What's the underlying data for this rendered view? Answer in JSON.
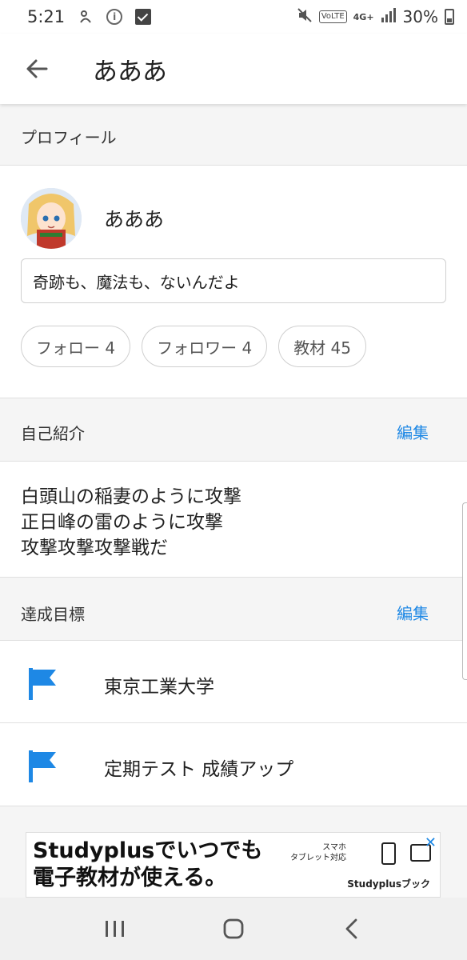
{
  "status_bar": {
    "time": "5:21",
    "network": "4G+",
    "volte": "VoLTE",
    "battery": "30%"
  },
  "app_bar": {
    "title": "あああ"
  },
  "profile": {
    "section_label": "プロフィール",
    "name": "あああ",
    "motto": "奇跡も、魔法も、ないんだよ",
    "chips": {
      "follow": "フォロー 4",
      "followers": "フォロワー 4",
      "materials": "教材 45"
    }
  },
  "intro": {
    "section_label": "自己紹介",
    "edit_label": "編集",
    "text": "白頭山の稲妻のように攻撃\n正日峰の雷のように攻撃\n攻撃攻撃攻撃戦だ"
  },
  "goals": {
    "section_label": "達成目標",
    "edit_label": "編集",
    "items": [
      {
        "label": "東京工業大学"
      },
      {
        "label": "定期テスト 成績アップ"
      }
    ],
    "flag_color": "#1e88e5"
  },
  "ad": {
    "headline": "Studyplusでいつでも\n電子教材が使える。",
    "sub": "スマホ\nタブレット対応",
    "brand": "Studyplusブック",
    "close": "✕"
  },
  "colors": {
    "accent": "#1e88e5"
  }
}
